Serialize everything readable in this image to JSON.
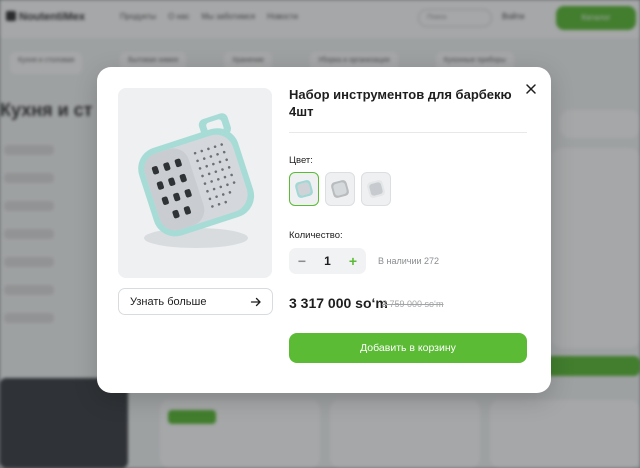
{
  "background": {
    "logo": "NoutentiMex",
    "nav": [
      "Продукты",
      "О нас",
      "Мы заботимся",
      "Новости"
    ],
    "search_placeholder": "Поиск",
    "login": "Войти",
    "cta": "Каталог",
    "categories": [
      "Кухня и столовая",
      "Бытовая химия",
      "Хранение",
      "Уборка и организация",
      "Кухонные приборы"
    ],
    "page_title": "Кухня и ст"
  },
  "modal": {
    "title": "Набор инструментов для барбекю 4шт",
    "color_label": "Цвет:",
    "color_options": [
      {
        "name": "мятный",
        "selected": true,
        "accent": "#9fd8d4"
      },
      {
        "name": "серый",
        "selected": false,
        "accent": "#b9bcbf"
      },
      {
        "name": "белый",
        "selected": false,
        "accent": "#e4e6e8"
      }
    ],
    "quantity_label": "Количество:",
    "quantity": {
      "minus": "−",
      "value": "1",
      "plus": "+"
    },
    "stock": "В наличии 272",
    "price": "3 317 000 so‘m",
    "old_price": "3 759 000 so‘m",
    "learn_more": "Узнать больше",
    "add_to_cart": "Добавить в корзину",
    "icons": {
      "close": "close-icon",
      "arrow": "arrow-right-icon"
    }
  },
  "colors": {
    "accent": "#5bbb35",
    "overlay": "rgba(30,34,38,0.40)",
    "text": "#1e1e1e",
    "muted": "#8a8d90"
  }
}
